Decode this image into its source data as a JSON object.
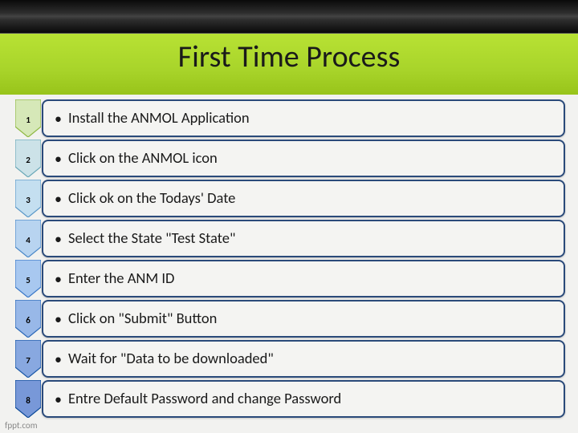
{
  "title": "First Time Process",
  "steps": [
    {
      "num": "1",
      "text": "Install the ANMOL Application",
      "fill": "#d6e8b8",
      "stroke": "#8fb843"
    },
    {
      "num": "2",
      "text": "Click on the ANMOL icon",
      "fill": "#cce2e8",
      "stroke": "#6aa8b8"
    },
    {
      "num": "3",
      "text": "Click ok on the Todays' Date",
      "fill": "#c4dff0",
      "stroke": "#5a98c8"
    },
    {
      "num": "4",
      "text": "Select the State \"Test State\"",
      "fill": "#b8d4f0",
      "stroke": "#4a88c8"
    },
    {
      "num": "5",
      "text": "Enter the ANM ID",
      "fill": "#a8c8f0",
      "stroke": "#3a78c8"
    },
    {
      "num": "6",
      "text": "Click on \"Submit\" Button",
      "fill": "#98b8e8",
      "stroke": "#2a68b8"
    },
    {
      "num": "7",
      "text": "Wait for \"Data to be downloaded\"",
      "fill": "#88a8e0",
      "stroke": "#1a58a8"
    },
    {
      "num": "8",
      "text": "Entre Default Password and change Password",
      "fill": "#7898d8",
      "stroke": "#0a4898"
    }
  ],
  "footer": "fppt.com"
}
